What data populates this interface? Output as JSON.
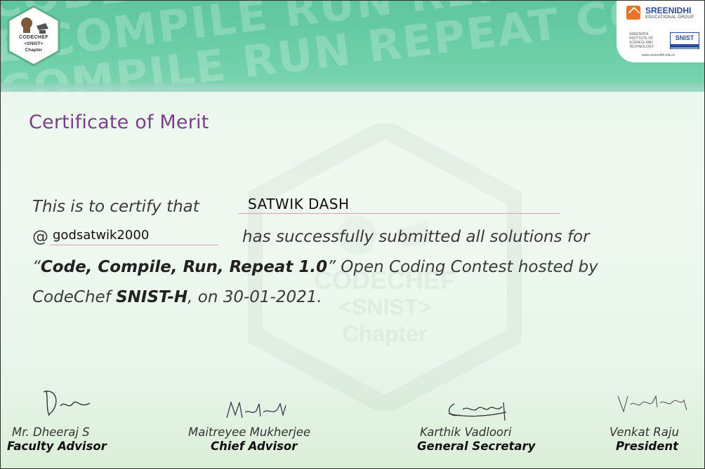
{
  "banner": {
    "background_words": [
      "CODE COMPILE RUN REPEAT CODE",
      "E COMPILE RUN REPEAT CODE CO",
      "COMPILE RUN REPEAT CODE COMPILE"
    ],
    "accent_color": "#6ccfa8"
  },
  "codechef_badge": {
    "line1": "CODECHEF",
    "line2": "<SNIST>",
    "line3": "Chapter"
  },
  "institution": {
    "name": "SREENIDHI",
    "group": "EDUCATIONAL GROUP",
    "institute_lines": "SREENIDHI INSTITUTE OF SCIENCE AND TECHNOLOGY",
    "badge": "SNIST",
    "url": "www.sreenidhi.edu.in"
  },
  "watermark": {
    "line1": "CODECHEF",
    "line2": "<SNIST>",
    "line3": "Chapter"
  },
  "certificate": {
    "title": "Certificate of Merit",
    "certify_text": "This is to certify that",
    "recipient_name": "SATWIK DASH",
    "at_sign": "@",
    "handle": "godsatwik2000",
    "submitted_text": "has successfully submitted all solutions for",
    "open_quote": "“",
    "contest_name": "Code, Compile, Run, Repeat 1.0",
    "contest_suffix": "” Open Coding Contest hosted by",
    "host_prefix": "CodeChef ",
    "host_bold": "SNIST-H",
    "date_text": ", on 30-01-2021."
  },
  "signatories": [
    {
      "name": "Mr. Dheeraj S",
      "role": "Faculty Advisor"
    },
    {
      "name": "Maitreyee Mukherjee",
      "role": "Chief Advisor"
    },
    {
      "name": "Karthik Vadloori",
      "role": "General Secretary"
    },
    {
      "name": "Venkat Raju",
      "role": "President"
    }
  ],
  "colors": {
    "title": "#7b3f8a",
    "underline": "#d9a0b8"
  }
}
